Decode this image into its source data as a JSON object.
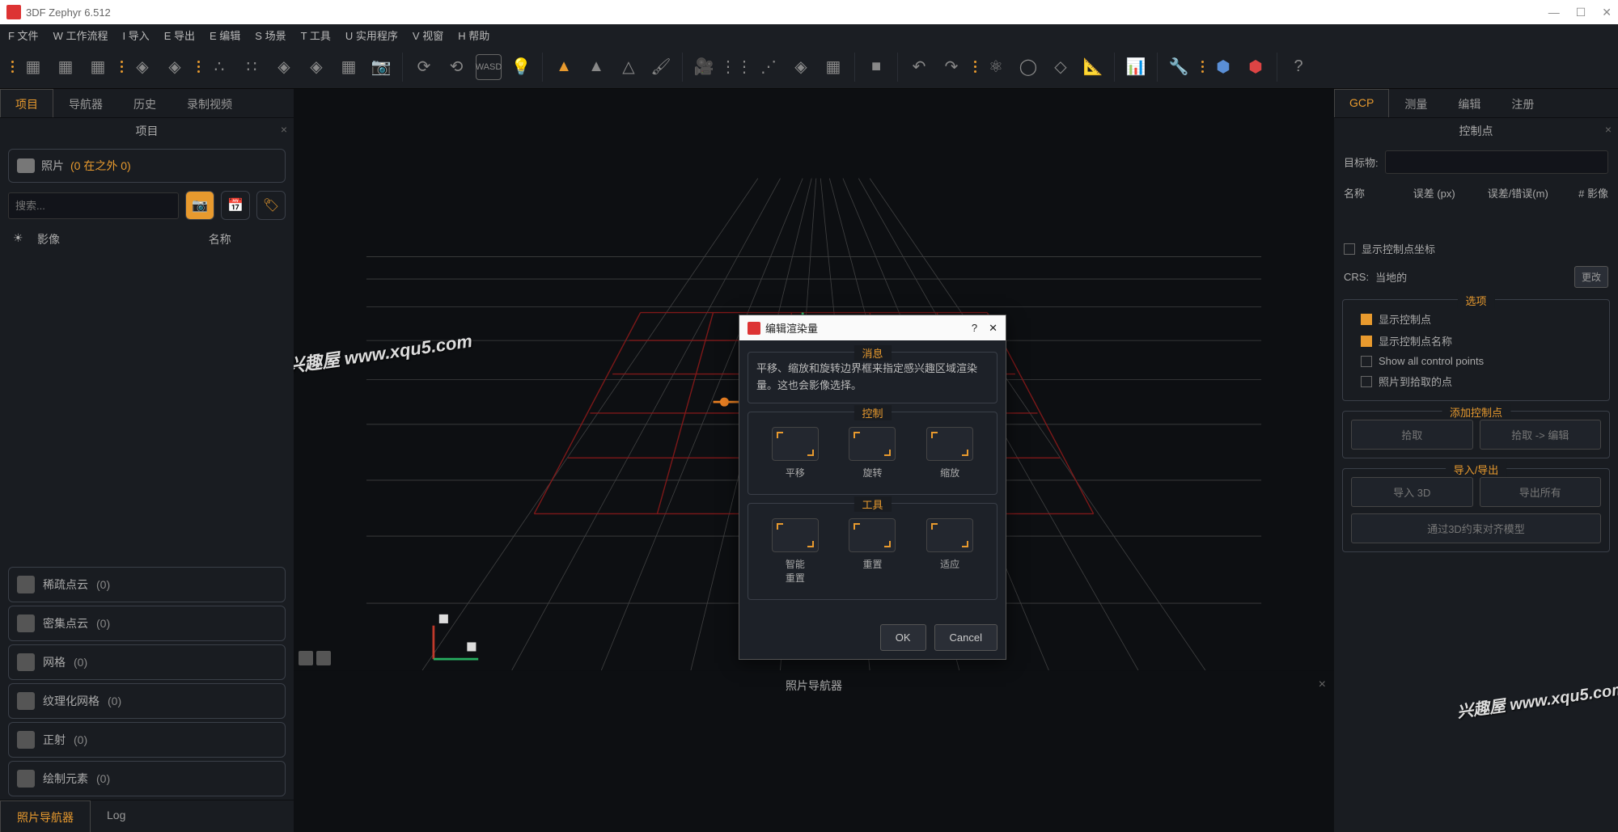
{
  "window": {
    "title": "3DF Zephyr 6.512"
  },
  "menu": {
    "items": [
      "F 文件",
      "W 工作流程",
      "I 导入",
      "E 导出",
      "E 编辑",
      "S 场景",
      "T 工具",
      "U 实用程序",
      "V 视窗",
      "H 帮助"
    ]
  },
  "left_tabs": [
    "项目",
    "导航器",
    "历史",
    "录制视频"
  ],
  "left_panel_title": "项目",
  "photos": {
    "label": "照片",
    "count_text": "(0 在之外 0)"
  },
  "search_placeholder": "搜索...",
  "list_cols": {
    "icon": "☀",
    "c2": "影像",
    "c3": "名称"
  },
  "categories": [
    {
      "name": "稀疏点云",
      "count": "(0)"
    },
    {
      "name": "密集点云",
      "count": "(0)"
    },
    {
      "name": "网格",
      "count": "(0)"
    },
    {
      "name": "纹理化网格",
      "count": "(0)"
    },
    {
      "name": "正射",
      "count": "(0)"
    },
    {
      "name": "绘制元素",
      "count": "(0)"
    }
  ],
  "bottom_tabs": [
    "照片导航器",
    "Log"
  ],
  "nav_title": "照片导航器",
  "right_tabs": [
    "GCP",
    "测量",
    "编辑",
    "注册"
  ],
  "right_panel_title": "控制点",
  "gcp": {
    "target_label": "目标物:",
    "cols": [
      "名称",
      "误差 (px)",
      "误差/错误(m)",
      "# 影像"
    ],
    "show_coords": "显示控制点坐标",
    "crs_label": "CRS:",
    "crs_value": "当地的",
    "crs_btn": "更改",
    "options_title": "选项",
    "opt1": "显示控制点",
    "opt2": "显示控制点名称",
    "opt3": "Show all control points",
    "opt4": "照片到拾取的点",
    "add_title": "添加控制点",
    "add_btns": [
      "拾取",
      "拾取 -> 编辑"
    ],
    "io_title": "导入/导出",
    "io_btns": [
      "导入 3D",
      "导出所有"
    ],
    "align_btn": "通过3D约束对齐模型"
  },
  "dialog": {
    "title": "编辑渲染量",
    "msg_title": "消息",
    "msg": "平移、缩放和旋转边界框来指定感兴趣区域渲染量。这也会影像选择。",
    "ctrl_title": "控制",
    "ctrls": [
      "平移",
      "旋转",
      "缩放"
    ],
    "tool_title": "工具",
    "tools": [
      "智能\n重置",
      "重置",
      "适应"
    ],
    "ok": "OK",
    "cancel": "Cancel"
  },
  "watermark": "兴趣屋 www.xqu5.com"
}
